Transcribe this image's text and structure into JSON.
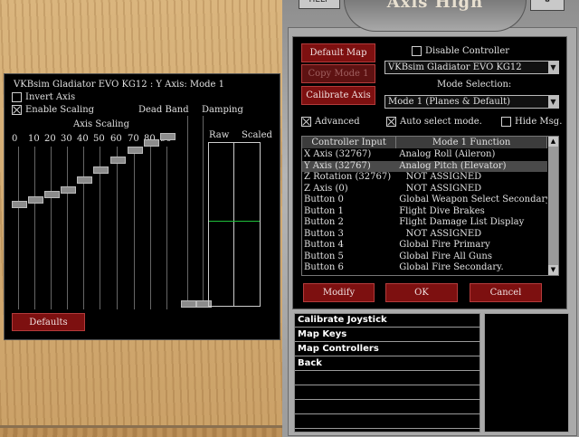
{
  "window": {
    "title": "Axis High",
    "help_label": "HELP"
  },
  "left_panel": {
    "header": "VKBsim Gladiator EVO KG12  :  Y Axis:  Mode 1",
    "invert_axis": {
      "label": "Invert Axis",
      "checked": false
    },
    "enable_scaling": {
      "label": "Enable Scaling",
      "checked": true
    },
    "axis_scaling_label": "Axis Scaling",
    "dead_band_label": "Dead Band",
    "damping_label": "Damping",
    "raw_label": "Raw",
    "scaled_label": "Scaled",
    "scale_ticks": [
      "0",
      "10",
      "20",
      "30",
      "40",
      "50",
      "60",
      "70",
      "80",
      "90"
    ],
    "scale_levels": [
      0.0,
      0.05,
      0.1,
      0.15,
      0.25,
      0.35,
      0.45,
      0.55,
      0.62,
      0.68
    ],
    "dead_band_level": 0,
    "damping_level": 0,
    "defaults_label": "Defaults"
  },
  "right_panel": {
    "default_map_label": "Default Map",
    "copy_mode_label": "Copy Mode 1",
    "calibrate_axis_label": "Calibrate Axis",
    "disable_controller": {
      "label": "Disable Controller",
      "checked": false
    },
    "controller_select": "VKBsim Gladiator EVO KG12",
    "mode_selection_label": "Mode Selection:",
    "mode_select": "Mode 1 (Planes & Default)",
    "advanced": {
      "label": "Advanced",
      "checked": true
    },
    "auto_select": {
      "label": "Auto select mode.",
      "checked": true
    },
    "hide_msg": {
      "label": "Hide Msg.",
      "checked": false
    },
    "table": {
      "col_input": "Controller Input",
      "col_function": "Mode 1 Function",
      "rows": [
        {
          "input": "X Axis (32767)",
          "function": "Analog Roll (Aileron)"
        },
        {
          "input": "Y Axis (32767)",
          "function": "Analog Pitch (Elevator)"
        },
        {
          "input": "Z Rotation (32767)",
          "function": "NOT ASSIGNED"
        },
        {
          "input": "Z Axis (0)",
          "function": "NOT ASSIGNED"
        },
        {
          "input": "Button 0",
          "function": "Global Weapon Select Secondary"
        },
        {
          "input": "Button 1",
          "function": "Flight Dive Brakes"
        },
        {
          "input": "Button 2",
          "function": "Flight Damage List Display"
        },
        {
          "input": "Button 3",
          "function": "NOT ASSIGNED"
        },
        {
          "input": "Button 4",
          "function": "Global Fire Primary"
        },
        {
          "input": "Button 5",
          "function": "Global Fire All Guns"
        },
        {
          "input": "Button 6",
          "function": "Global Fire Secondary."
        }
      ]
    },
    "modify_label": "Modify",
    "ok_label": "OK",
    "cancel_label": "Cancel"
  },
  "menu": {
    "items": [
      "Calibrate Joystick",
      "Map Keys",
      "Map Controllers",
      "Back",
      "",
      "",
      "",
      ""
    ]
  }
}
